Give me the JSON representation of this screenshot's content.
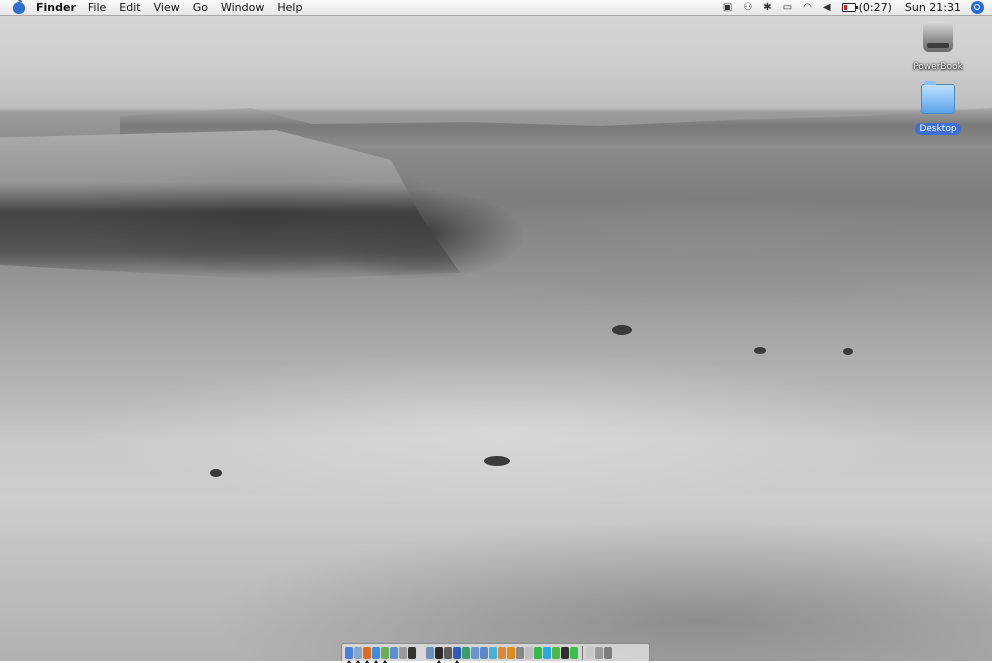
{
  "menubar": {
    "app_name": "Finder",
    "menus": [
      "File",
      "Edit",
      "View",
      "Go",
      "Window",
      "Help"
    ],
    "status": {
      "icons": [
        "timemachine-icon",
        "binoculars-icon",
        "bluetooth-icon",
        "display-icon",
        "wifi-icon",
        "volume-icon"
      ],
      "battery_text": "(0:27)",
      "clock": "Sun 21:31"
    }
  },
  "desktop": {
    "icons": [
      {
        "label": "PowerBook",
        "kind": "hard-drive"
      },
      {
        "label": "Desktop",
        "kind": "folder",
        "selected": true
      }
    ]
  },
  "dock": {
    "items": [
      {
        "name": "finder",
        "color": "#4a7fd9",
        "running": true
      },
      {
        "name": "mail",
        "color": "#8aa7c9",
        "running": true
      },
      {
        "name": "firefox",
        "color": "#e06a1c",
        "running": true
      },
      {
        "name": "safari",
        "color": "#3b8ee0",
        "running": true
      },
      {
        "name": "ichat",
        "color": "#6ab14d",
        "running": true
      },
      {
        "name": "itunes",
        "color": "#5b8fd6",
        "running": false
      },
      {
        "name": "iphoto",
        "color": "#9b9b9b",
        "running": false
      },
      {
        "name": "terminal",
        "color": "#333333",
        "running": false
      },
      {
        "name": "textedit",
        "color": "#d8d8d8",
        "running": false
      },
      {
        "name": "preview",
        "color": "#6a8fb8",
        "running": false
      },
      {
        "name": "camino",
        "color": "#2b2b2b",
        "running": true
      },
      {
        "name": "dashboard",
        "color": "#5a5a5a",
        "running": false
      },
      {
        "name": "word",
        "color": "#2b5cb8",
        "running": true
      },
      {
        "name": "excel",
        "color": "#3aa06a",
        "running": false
      },
      {
        "name": "music",
        "color": "#6a93d6",
        "running": false
      },
      {
        "name": "quicktime",
        "color": "#5a88c8",
        "running": false
      },
      {
        "name": "network",
        "color": "#4bb0d8",
        "running": false
      },
      {
        "name": "photos",
        "color": "#d88a3c",
        "running": false
      },
      {
        "name": "vlc",
        "color": "#e08a1c",
        "running": false
      },
      {
        "name": "keynote",
        "color": "#888888",
        "running": false
      },
      {
        "name": "activity",
        "color": "#bdbdbd",
        "running": false
      },
      {
        "name": "utility",
        "color": "#35b84a",
        "running": false
      },
      {
        "name": "skype",
        "color": "#2aa6e0",
        "running": false
      },
      {
        "name": "messenger",
        "color": "#4fb848",
        "running": false
      },
      {
        "name": "transmission",
        "color": "#2e2e2e",
        "running": false
      },
      {
        "name": "greendot",
        "color": "#3fbf4a",
        "running": false
      }
    ],
    "trailing_items": [
      {
        "name": "documents-stack",
        "color": "#c8c8c8"
      },
      {
        "name": "downloads-stack",
        "color": "#9a9a9a"
      },
      {
        "name": "trash",
        "color": "#7d7d7d"
      }
    ]
  }
}
